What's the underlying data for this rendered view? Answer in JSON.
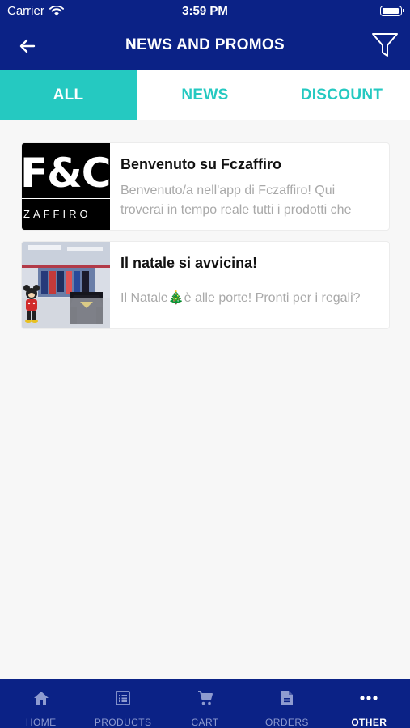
{
  "status": {
    "carrier": "Carrier",
    "time": "3:59 PM"
  },
  "header": {
    "title": "NEWS AND PROMOS"
  },
  "tabs": [
    {
      "label": "ALL",
      "active": true
    },
    {
      "label": "NEWS",
      "active": false
    },
    {
      "label": "DISCOUNT",
      "active": false
    }
  ],
  "items": [
    {
      "title": "Benvenuto su Fczaffiro",
      "body": "Benvenuto/a nell'app di Fczaffiro! Qui troverai in tempo reale tutti i prodotti che",
      "logo_main": "F&C",
      "logo_sub": "ZAFFIRO"
    },
    {
      "title": "Il natale si avvicina!",
      "body_before": "Il Natale",
      "body_emoji": "🎄",
      "body_after": "è alle porte! Pronti per i regali?"
    }
  ],
  "bottom_nav": [
    {
      "label": "HOME",
      "icon": "home-icon"
    },
    {
      "label": "PRODUCTS",
      "icon": "list-icon"
    },
    {
      "label": "CART",
      "icon": "cart-icon"
    },
    {
      "label": "ORDERS",
      "icon": "document-icon"
    },
    {
      "label": "OTHER",
      "icon": "more-icon",
      "active": true
    }
  ],
  "colors": {
    "primary": "#0b2286",
    "accent": "#25c9c1",
    "muted_text": "#a9a9a9"
  }
}
